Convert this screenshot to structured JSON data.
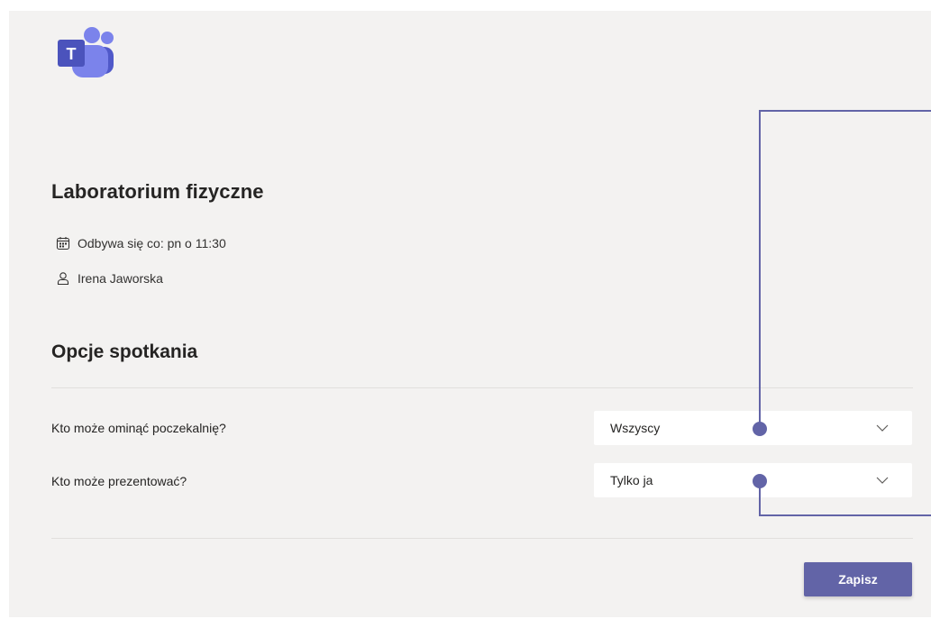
{
  "app": {
    "logo_icon": "microsoft-teams-logo",
    "logo_letter": "T",
    "accent_color": "#6264a7"
  },
  "meeting": {
    "title": "Laboratorium fizyczne",
    "recurrence_icon": "calendar-icon",
    "recurrence": "Odbywa się co: pn o 11:30",
    "organizer_icon": "person-icon",
    "organizer": "Irena Jaworska"
  },
  "options": {
    "heading": "Opcje spotkania",
    "lobby_bypass": {
      "label": "Kto może ominąć poczekalnię?",
      "value": "Wszyscy"
    },
    "presenters": {
      "label": "Kto może prezentować?",
      "value": "Tylko ja"
    },
    "dropdown_icon": "chevron-down-icon"
  },
  "actions": {
    "save_label": "Zapisz"
  },
  "annotation": {
    "color": "#6264a7"
  }
}
